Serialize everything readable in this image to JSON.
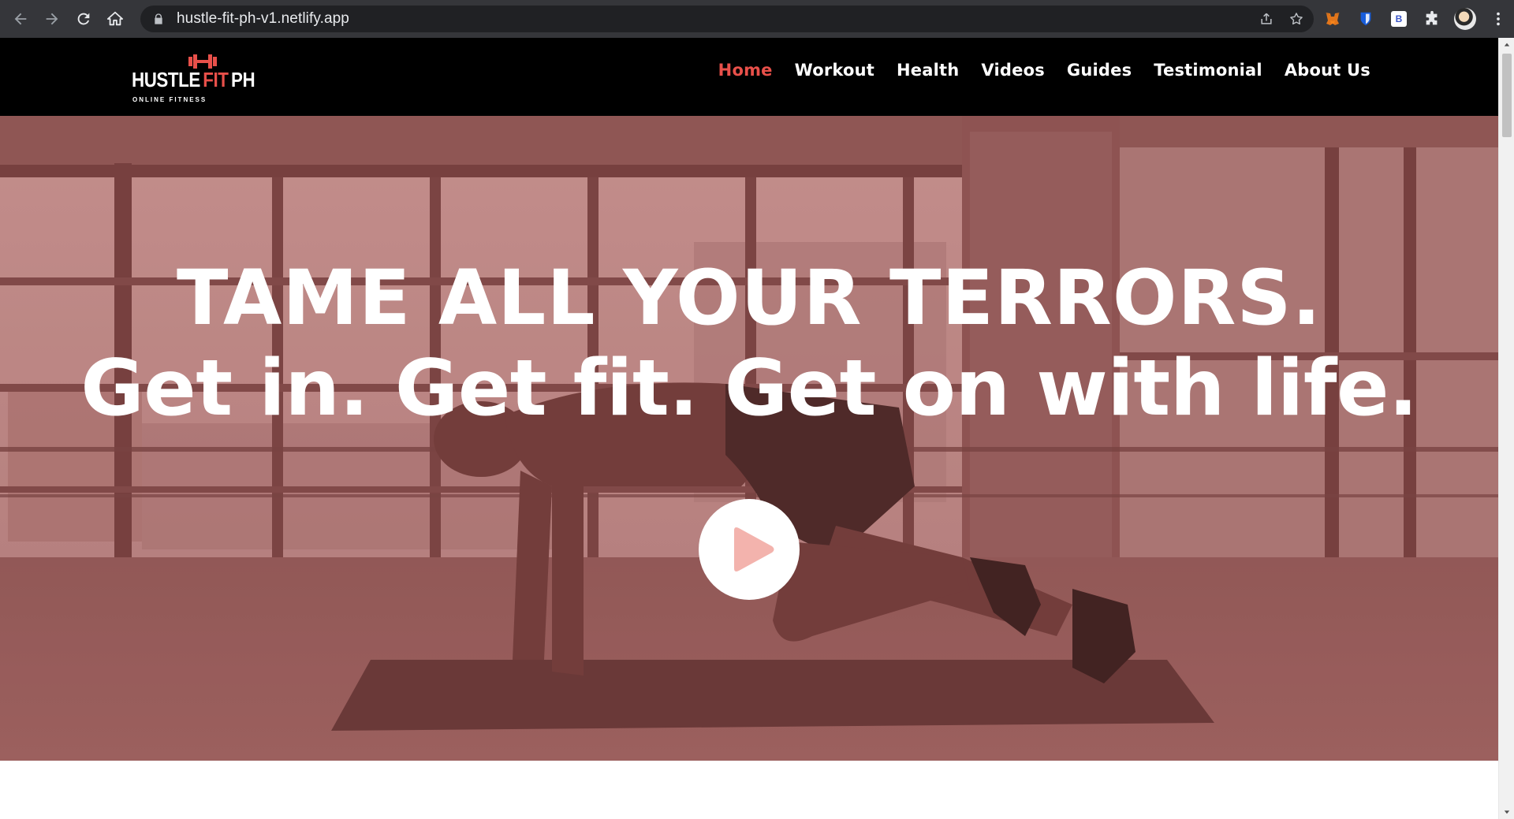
{
  "browser": {
    "url": "hustle-fit-ph-v1.netlify.app",
    "icons": [
      "back-arrow-icon",
      "forward-arrow-icon",
      "reload-icon",
      "home-icon",
      "lock-icon",
      "share-icon",
      "star-icon",
      "metamask-fox-icon",
      "bitwarden-shield-icon",
      "b-extension-icon",
      "puzzle-extensions-icon",
      "profile-avatar",
      "kebab-menu-icon"
    ]
  },
  "site": {
    "logo": {
      "hustle": "HUSTLE",
      "fit": "FIT",
      "ph": "PH",
      "tagline": "ONLINE FITNESS"
    },
    "nav": [
      {
        "label": "Home",
        "active": true
      },
      {
        "label": "Workout",
        "active": false
      },
      {
        "label": "Health",
        "active": false
      },
      {
        "label": "Videos",
        "active": false
      },
      {
        "label": "Guides",
        "active": false
      },
      {
        "label": "Testimonial",
        "active": false
      },
      {
        "label": "About Us",
        "active": false
      }
    ]
  },
  "hero": {
    "headline_line1": "TAME ALL YOUR TERRORS.",
    "headline_line2": "Get in. Get fit. Get on with life.",
    "play_icon": "play-icon"
  },
  "colors": {
    "accent": "#e8504a",
    "header_bg": "#000000",
    "hero_tint": "#a4716f",
    "chrome_bg": "#35363a"
  }
}
